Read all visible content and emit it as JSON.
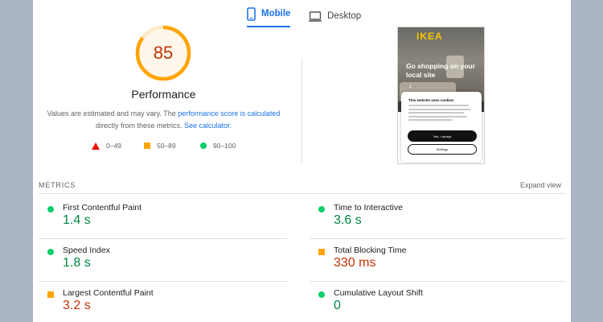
{
  "tabs": [
    {
      "label": "Mobile",
      "icon": "mobile-icon",
      "active": true
    },
    {
      "label": "Desktop",
      "icon": "desktop-icon",
      "active": false
    }
  ],
  "performance": {
    "score": "85",
    "score_fraction": 0.85,
    "title": "Performance",
    "desc_prefix": "Values are estimated and may vary. The ",
    "desc_link": "performance score is calculated",
    "desc_middle": " directly from these metrics. ",
    "desc_link2": "See calculator.",
    "legend": [
      {
        "icon": "fail-triangle-icon",
        "label": "0–49"
      },
      {
        "icon": "average-square-icon",
        "label": "50–89"
      },
      {
        "icon": "pass-circle-icon",
        "label": "90–100"
      }
    ]
  },
  "screenshot": {
    "logo": "IKEA",
    "headline": "Go shopping on your local site",
    "arrow": "↓",
    "cookie_title": "This website uses cookies",
    "cookie_accept": "Yes, I accept",
    "cookie_settings": "Settings"
  },
  "metrics": {
    "label": "METRICS",
    "expand": "Expand view",
    "items": [
      {
        "name": "First Contentful Paint",
        "value": "1.4 s",
        "rating": "good"
      },
      {
        "name": "Time to Interactive",
        "value": "3.6 s",
        "rating": "good"
      },
      {
        "name": "Speed Index",
        "value": "1.8 s",
        "rating": "good"
      },
      {
        "name": "Total Blocking Time",
        "value": "330 ms",
        "rating": "average"
      },
      {
        "name": "Largest Contentful Paint",
        "value": "3.2 s",
        "rating": "average"
      },
      {
        "name": "Cumulative Layout Shift",
        "value": "0",
        "rating": "good"
      }
    ]
  },
  "colors": {
    "accent": "#1a73e8",
    "pass": "#0cce6b",
    "pass_text": "#018642",
    "average": "#ffa400",
    "average_text": "#c33300",
    "fail": "#eb0f00",
    "background": "#aab4c4"
  }
}
